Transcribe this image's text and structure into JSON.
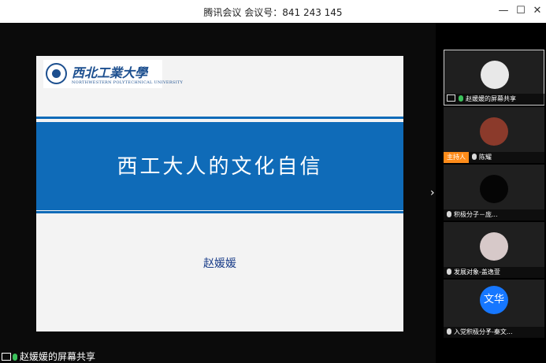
{
  "window": {
    "title": "腾讯会议 会议号：841 243 145",
    "minimize": "—",
    "maximize": "☐",
    "close": "✕"
  },
  "slide": {
    "logo_cn": "西北工業大學",
    "logo_en": "NORTHWESTERN POLYTECHNICAL UNIVERSITY",
    "title": "西工大人的文化自信",
    "author": "赵媛媛"
  },
  "participants": [
    {
      "name": "赵媛媛的屏幕共享",
      "host": false,
      "avatar_color": "#e8e8e8"
    },
    {
      "name": "陈耀",
      "host": true,
      "host_label": "主持人",
      "avatar_color": "#8b3a2b"
    },
    {
      "name": "积极分子－庞...",
      "host": false,
      "avatar_color": "#050505"
    },
    {
      "name": "发展对象-盖逸萱",
      "host": false,
      "avatar_color": "#d7c9c9"
    },
    {
      "name": "入党积极分子-秦文...",
      "host": false,
      "avatar_text": "文华",
      "avatar_color": "#1677ff"
    }
  ],
  "status": {
    "sharing_label": "赵媛媛的屏幕共享"
  },
  "icons": {
    "next": "›",
    "collapse": "⌄"
  }
}
